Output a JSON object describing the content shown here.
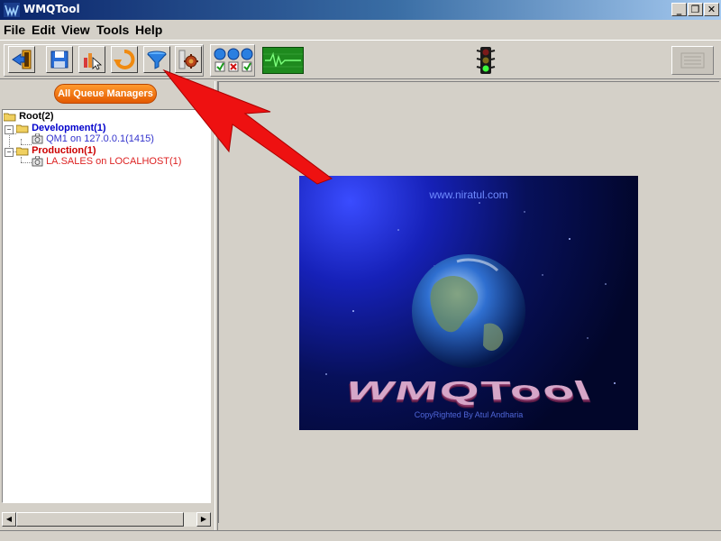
{
  "window": {
    "title": "WMQTool"
  },
  "menu": [
    "File",
    "Edit",
    "View",
    "Tools",
    "Help"
  ],
  "toolbar": {
    "buttons": [
      "exit-icon",
      "save-icon",
      "pointer-chart-icon",
      "refresh-icon",
      "filter-icon",
      "settings-icon"
    ],
    "status_lights": "three-lights-icon",
    "monitor": "monitor-icon",
    "traffic_light": "traffic-light-icon"
  },
  "left_panel": {
    "queue_managers_button": "All Queue Managers",
    "tree": {
      "root": {
        "label": "Root",
        "count": "(2)"
      },
      "groups": [
        {
          "label": "Development(1)",
          "color": "#0000cc",
          "children": [
            "QM1 on 127.0.0.1(1415)"
          ],
          "child_color": "#3333cc"
        },
        {
          "label": "Production(1)",
          "color": "#cc0000",
          "children": [
            "LA.SALES on LOCALHOST(1)"
          ],
          "child_color": "#dd2222"
        }
      ]
    }
  },
  "splash": {
    "url": "www.niratul.com",
    "logo": "WMQTool",
    "copyright": "CopyRighted By Atul Andharia"
  },
  "colors": {
    "annotation_arrow": "#ee1111",
    "titlebar": "#0a246a"
  }
}
